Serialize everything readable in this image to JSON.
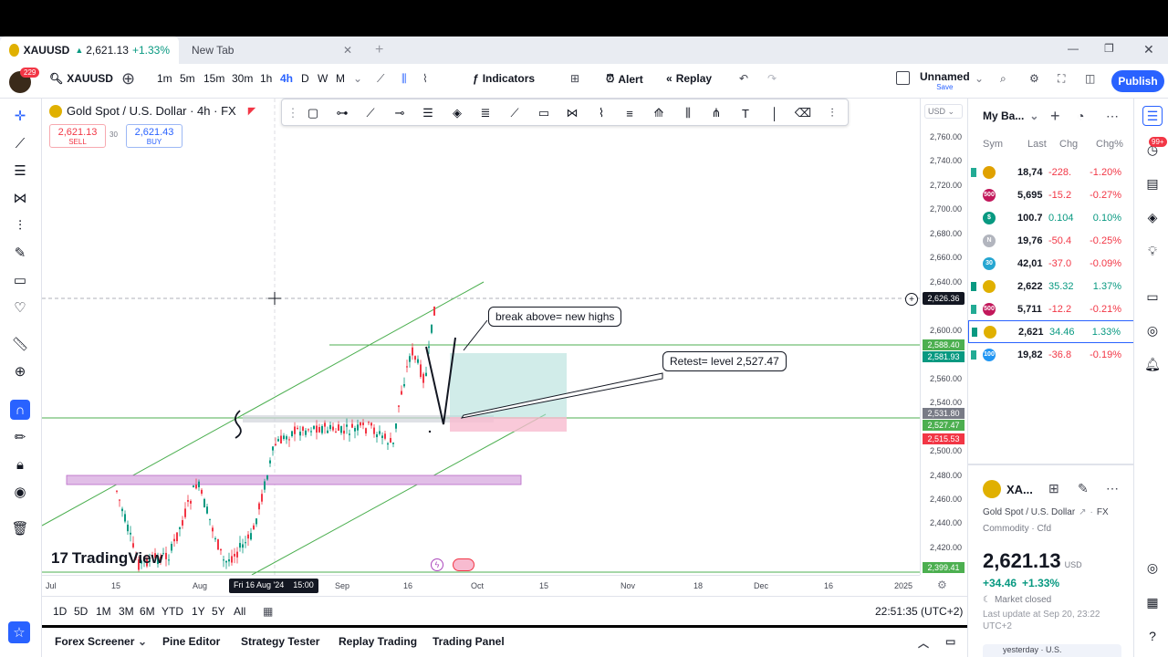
{
  "tabs": [
    {
      "symbol": "XAUUSD",
      "price": "2,621.13",
      "change": "+1.33%"
    },
    {
      "label": "New Tab"
    }
  ],
  "toolbar": {
    "avatar_badge": "229",
    "symbol": "XAUUSD",
    "intervals": [
      "1m",
      "5m",
      "15m",
      "30m",
      "1h",
      "4h",
      "D",
      "W",
      "M"
    ],
    "active_interval": "4h",
    "indicators_label": "Indicators",
    "alert_label": "Alert",
    "replay_label": "Replay",
    "layout_name": "Unnamed",
    "layout_sub": "Save",
    "publish_label": "Publish"
  },
  "legend": {
    "title": "Gold Spot / U.S. Dollar · 4h · FX",
    "sell_price": "2,621.13",
    "sell_label": "SELL",
    "spread": "30",
    "buy_price": "2,621.43",
    "buy_label": "BUY",
    "currency": "USD"
  },
  "price_axis": {
    "labels": [
      "2,760.00",
      "2,740.00",
      "2,720.00",
      "2,700.00",
      "2,680.00",
      "2,660.00",
      "2,640.00",
      "2,600.00",
      "2,560.00",
      "2,540.00",
      "2,500.00",
      "2,480.00",
      "2,460.00",
      "2,440.00",
      "2,420.00"
    ],
    "crosshair": "2,626.36",
    "tag_green1": "2,588.40",
    "tag_green2": "2,581.93",
    "tag_gray": "2,531.80",
    "tag_green3": "2,527.47",
    "tag_red": "2,515.53",
    "tag_bottom": "2,399.41"
  },
  "time_axis": {
    "labels": [
      "Jul",
      "15",
      "Aug",
      "Sep",
      "16",
      "Oct",
      "15",
      "Nov",
      "18",
      "Dec",
      "16",
      "2025"
    ],
    "crosshair": "Fri 16 Aug '24",
    "crosshair_time": "15:00"
  },
  "annotations": {
    "callout1": "break above= new highs",
    "callout2": "Retest= level 2,527.47"
  },
  "watermark": "TradingView",
  "range": {
    "buttons": [
      "1D",
      "5D",
      "1M",
      "3M",
      "6M",
      "YTD",
      "1Y",
      "5Y",
      "All"
    ],
    "clock": "22:51:35 (UTC+2)"
  },
  "bottom_tabs": [
    "Forex Screener",
    "Pine Editor",
    "Strategy Tester",
    "Replay Trading",
    "Trading Panel"
  ],
  "watchlist": {
    "title": "My Ba...",
    "headers": {
      "sym": "Sym",
      "last": "Last",
      "chg": "Chg",
      "pct": "Chg%"
    },
    "rows": [
      {
        "icon": "",
        "color": "#e0a100",
        "last": "18,74",
        "chg": "-228.",
        "pct": "-1.20%",
        "dir": "down"
      },
      {
        "icon": "500",
        "color": "#c2185b",
        "last": "5,695",
        "chg": "-15.2",
        "pct": "-0.27%",
        "dir": "down"
      },
      {
        "icon": "$",
        "color": "#089981",
        "last": "100.7",
        "chg": "0.104",
        "pct": "0.10%",
        "dir": "up"
      },
      {
        "icon": "N",
        "color": "#b2b5be",
        "last": "19,76",
        "chg": "-50.4",
        "pct": "-0.25%",
        "dir": "down"
      },
      {
        "icon": "30",
        "color": "#26a6d1",
        "last": "42,01",
        "chg": "-37.0",
        "pct": "-0.09%",
        "dir": "down"
      },
      {
        "icon": "",
        "color": "#e0b000",
        "last": "2,622",
        "chg": "35.32",
        "pct": "1.37%",
        "dir": "up"
      },
      {
        "icon": "500",
        "color": "#c2185b",
        "last": "5,711",
        "chg": "-12.2",
        "pct": "-0.21%",
        "dir": "down"
      },
      {
        "icon": "",
        "color": "#e0b000",
        "last": "2,621",
        "chg": "34.46",
        "pct": "1.33%",
        "dir": "up"
      },
      {
        "icon": "100",
        "color": "#2196f3",
        "last": "19,82",
        "chg": "-36.8",
        "pct": "-0.19%",
        "dir": "down"
      }
    ]
  },
  "details": {
    "symbol": "XA...",
    "name": "Gold Spot / U.S. Dollar",
    "exchange": "FX",
    "type": "Commodity · Cfd",
    "price": "2,621.13",
    "currency": "USD",
    "change": "+34.46",
    "change_pct": "+1.33%",
    "status": "Market closed",
    "last_update": "Last update at Sep 20, 23:22 UTC+2",
    "news": "yesterday · U.S."
  },
  "right_badge": "99+",
  "colors": {
    "accent": "#2962ff",
    "up": "#089981",
    "down": "#f23645",
    "channel": "#4caf50"
  }
}
